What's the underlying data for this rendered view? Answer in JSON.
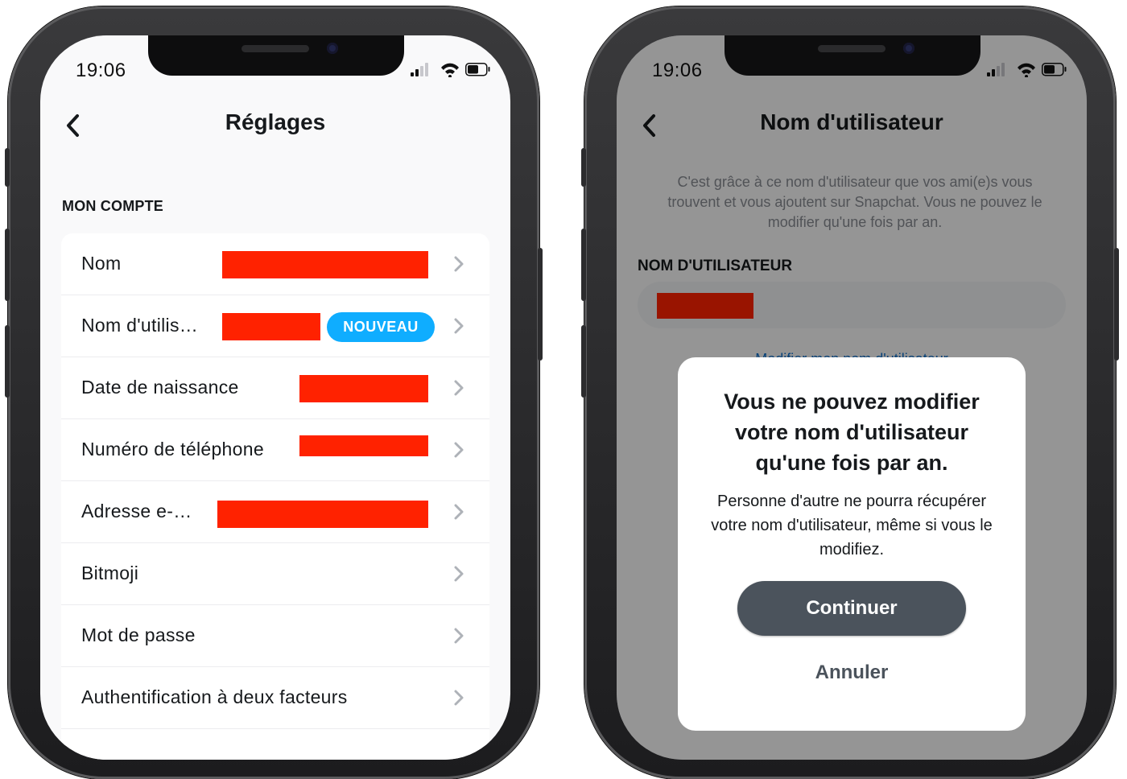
{
  "left_screen": {
    "status_time": "19:06",
    "nav_title": "Réglages",
    "section_header": "MON COMPTE",
    "rows": [
      {
        "label": "Nom"
      },
      {
        "label": "Nom d'utilis…",
        "badge": "NOUVEAU"
      },
      {
        "label": "Date de naissance"
      },
      {
        "label": "Numéro de téléphone"
      },
      {
        "label": "Adresse e-…"
      },
      {
        "label": "Bitmoji"
      },
      {
        "label": "Mot de passe"
      },
      {
        "label": "Authentification à deux facteurs"
      }
    ]
  },
  "right_screen": {
    "status_time": "19:06",
    "nav_title": "Nom d'utilisateur",
    "description": "C'est grâce à ce nom d'utilisateur que vos ami(e)s vous trouvent et vous ajoutent sur Snapchat. Vous ne pouvez le modifier qu'une fois par an.",
    "field_label": "NOM D'UTILISATEUR",
    "link_text": "Modifier mon nom d'utilisateur",
    "modal": {
      "title": "Vous ne pouvez modifier votre nom d'utilisateur qu'une fois par an.",
      "body": "Personne d'autre ne pourra récupérer votre nom d'utilisateur, même si vous le modifiez.",
      "primary_button": "Continuer",
      "secondary_button": "Annuler"
    }
  },
  "colors": {
    "redaction": "#ff2200",
    "badge": "#0fadff",
    "primary_button": "#4b535c"
  },
  "icons": [
    "back-chevron-icon",
    "chevron-right-icon",
    "cellular-signal-icon",
    "wifi-icon",
    "battery-icon"
  ]
}
